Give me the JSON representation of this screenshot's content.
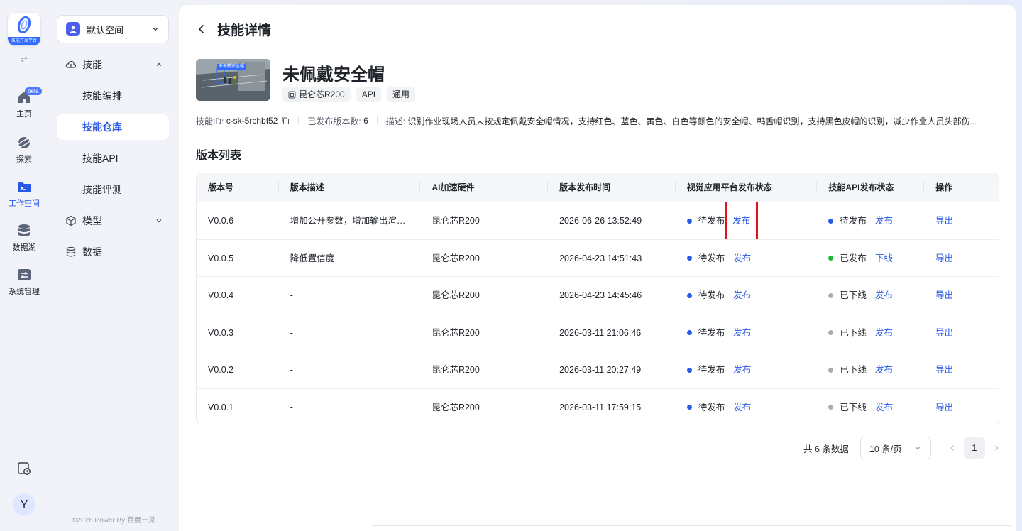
{
  "logo": {
    "text": "技能开发平台"
  },
  "rail": {
    "items": [
      {
        "label": "主页",
        "badge": "beta",
        "icon": "home-icon"
      },
      {
        "label": "探索",
        "icon": "explore-icon"
      },
      {
        "label": "工作空间",
        "icon": "workspace-icon",
        "active": true
      },
      {
        "label": "数据湖",
        "icon": "database-icon"
      },
      {
        "label": "系统管理",
        "icon": "settings-panel-icon"
      }
    ],
    "avatar": "Y"
  },
  "sidebar": {
    "space": "默认空间",
    "groups": [
      {
        "label": "技能",
        "expanded": true
      },
      {
        "label": "模型",
        "expanded": false
      },
      {
        "label": "数据"
      }
    ],
    "sub_items": [
      "技能编排",
      "技能仓库",
      "技能API",
      "技能评测"
    ],
    "active_sub": "技能仓库",
    "copyright": "©2026 Power By 百度一见"
  },
  "header": {
    "title": "技能详情"
  },
  "skill": {
    "thumb_text": "未佩戴安全帽",
    "name": "未佩戴安全帽",
    "tags": [
      "昆仑芯R200",
      "API",
      "通用"
    ],
    "id_label": "技能ID:",
    "id_value": "c-sk-5rchbf52",
    "versions_label": "已发布版本数:",
    "versions_value": "6",
    "desc_label": "描述:",
    "desc_value": "识别作业现场人员未按规定佩戴安全帽情况，支持红色、蓝色、黄色、白色等颜色的安全帽、鸭舌帽识别，支持黑色皮帽的识别，减少作业人员头部伤..."
  },
  "section_title": "版本列表",
  "table": {
    "headers": [
      "版本号",
      "版本描述",
      "AI加速硬件",
      "版本发布时间",
      "视觉应用平台发布状态",
      "技能API发布状态",
      "操作"
    ],
    "rows": [
      {
        "version": "V0.0.6",
        "desc": "增加公开参数，增加输出渲染...",
        "hw": "昆仑芯R200",
        "time": "2026-06-26 13:52:49",
        "vis_status": "待发布",
        "vis_action": "发布",
        "api_status": "待发布",
        "api_action": "发布",
        "op": "导出"
      },
      {
        "version": "V0.0.5",
        "desc": "降低置信度",
        "hw": "昆仑芯R200",
        "time": "2026-04-23 14:51:43",
        "vis_status": "待发布",
        "vis_action": "发布",
        "api_status": "已发布",
        "api_action": "下线",
        "op": "导出"
      },
      {
        "version": "V0.0.4",
        "desc": "-",
        "hw": "昆仑芯R200",
        "time": "2026-04-23 14:45:46",
        "vis_status": "待发布",
        "vis_action": "发布",
        "api_status": "已下线",
        "api_action": "发布",
        "op": "导出"
      },
      {
        "version": "V0.0.3",
        "desc": "-",
        "hw": "昆仑芯R200",
        "time": "2026-03-11 21:06:46",
        "vis_status": "待发布",
        "vis_action": "发布",
        "api_status": "已下线",
        "api_action": "发布",
        "op": "导出"
      },
      {
        "version": "V0.0.2",
        "desc": "-",
        "hw": "昆仑芯R200",
        "time": "2026-03-11 20:27:49",
        "vis_status": "待发布",
        "vis_action": "发布",
        "api_status": "已下线",
        "api_action": "发布",
        "op": "导出"
      },
      {
        "version": "V0.0.1",
        "desc": "-",
        "hw": "昆仑芯R200",
        "time": "2026-03-11 17:59:15",
        "vis_status": "待发布",
        "vis_action": "发布",
        "api_status": "已下线",
        "api_action": "发布",
        "op": "导出"
      }
    ]
  },
  "status_colors": {
    "待发布": "#2859e8",
    "已发布": "#22b33a",
    "已下线": "#a7adb8"
  },
  "pagination": {
    "total": "共 6 条数据",
    "page_size": "10 条/页",
    "current": "1"
  }
}
